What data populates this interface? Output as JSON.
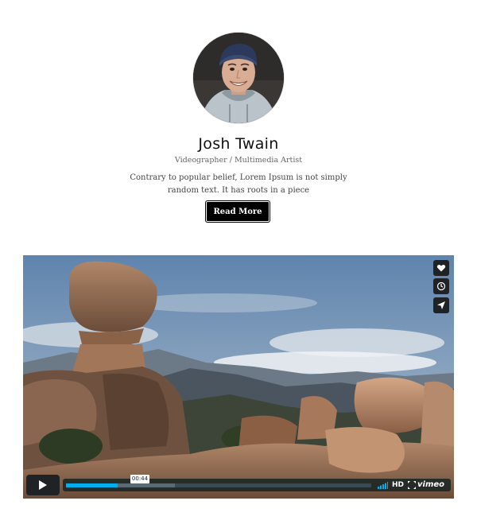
{
  "profile": {
    "name": "Josh Twain",
    "role": "Videographer / Multimedia Artist",
    "bio": "Contrary to popular belief, Lorem Ipsum is not simply random text. It has roots in a piece",
    "read_more_label": "Read More"
  },
  "video": {
    "current_time": "00:44",
    "progress_fraction": 0.17,
    "quality_label": "HD",
    "brand_label": "vimeo",
    "side_actions": [
      "heart-icon",
      "clock-icon",
      "send-icon"
    ],
    "accent_color": "#00adef"
  }
}
